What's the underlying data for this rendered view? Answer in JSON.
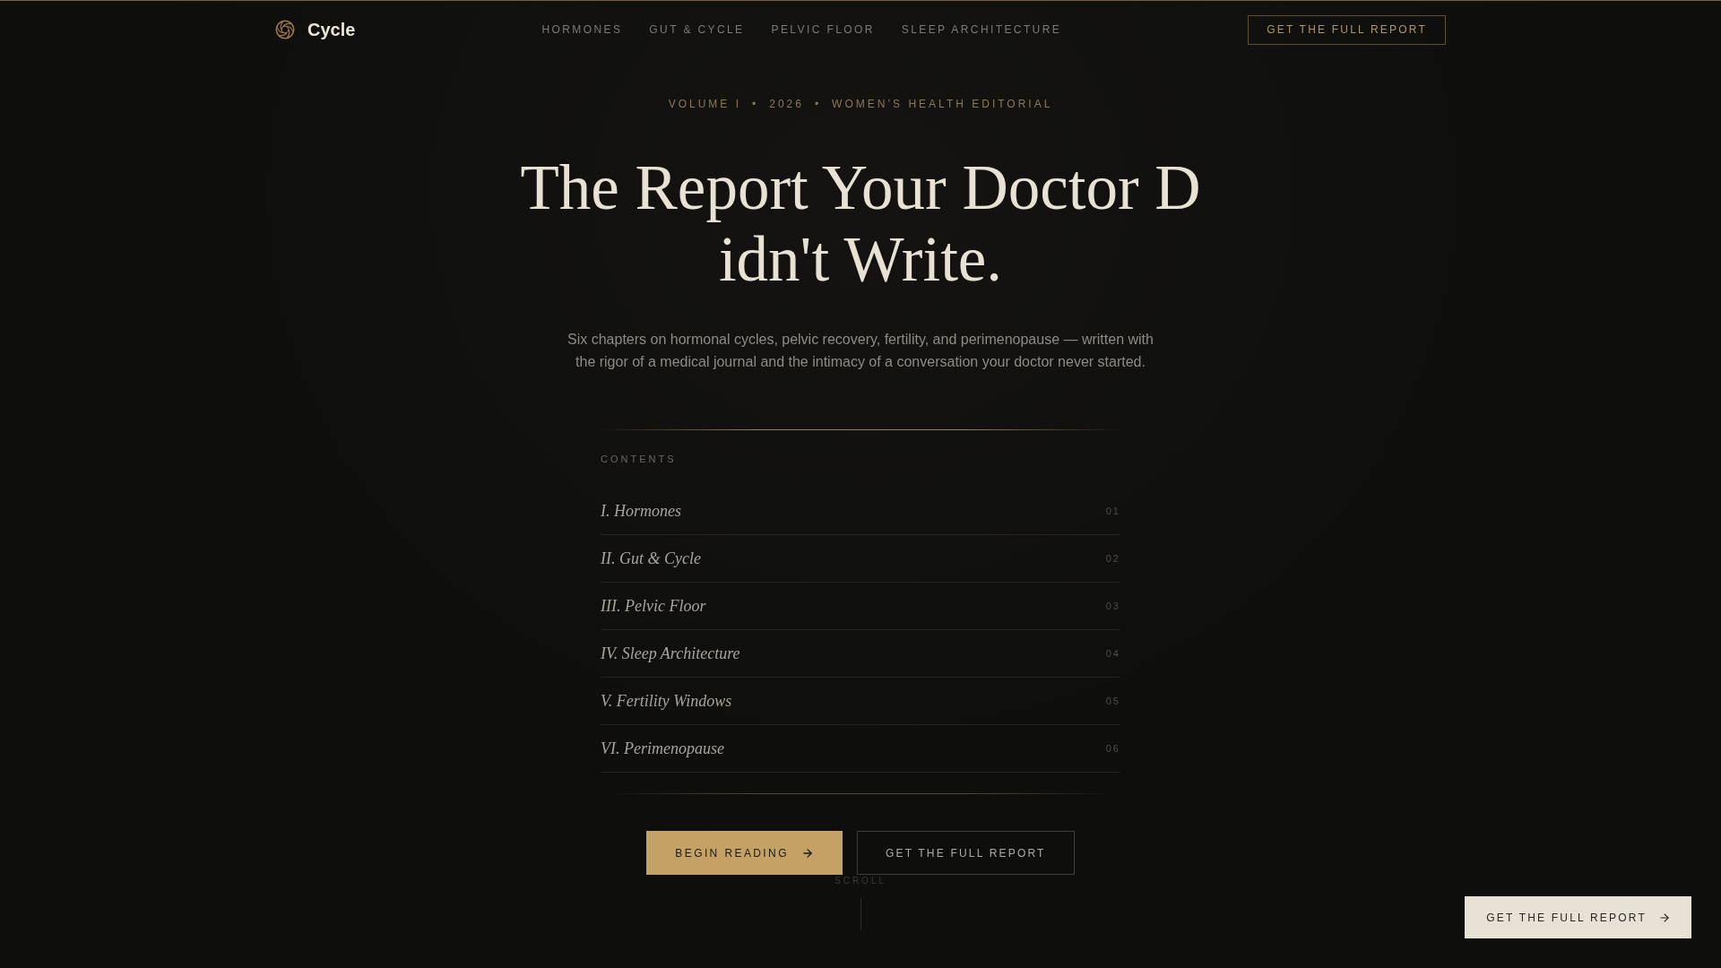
{
  "nav": {
    "brand": "Cycle",
    "links": [
      "HORMONES",
      "GUT & CYCLE",
      "PELVIC FLOOR",
      "SLEEP ARCHITECTURE"
    ],
    "cta": "GET THE FULL REPORT"
  },
  "hero": {
    "eyebrow": [
      "VOLUME I",
      "•",
      "2026",
      "•",
      "WOMEN’S HEALTH EDITORIAL"
    ],
    "title": "The Report Your Doctor Didn't Write.",
    "subtitle": "Six chapters on hormonal cycles, pelvic recovery, fertility, and perimenopause — written with the rigor of a medical journal and the intimacy of a conversation your doctor never started."
  },
  "contents": {
    "label": "CONTENTS",
    "chapters": [
      {
        "title": "I. Hormones",
        "number": "01"
      },
      {
        "title": "II. Gut & Cycle",
        "number": "02"
      },
      {
        "title": "III. Pelvic Floor",
        "number": "03"
      },
      {
        "title": "IV. Sleep Architecture",
        "number": "04"
      },
      {
        "title": "V. Fertility Windows",
        "number": "05"
      },
      {
        "title": "VI. Perimenopause",
        "number": "06"
      }
    ]
  },
  "actions": {
    "primary": "BEGIN READING",
    "secondary": "GET THE FULL REPORT"
  },
  "scroll_hint": "SCROLL",
  "floating_cta": "GET THE FULL REPORT"
}
